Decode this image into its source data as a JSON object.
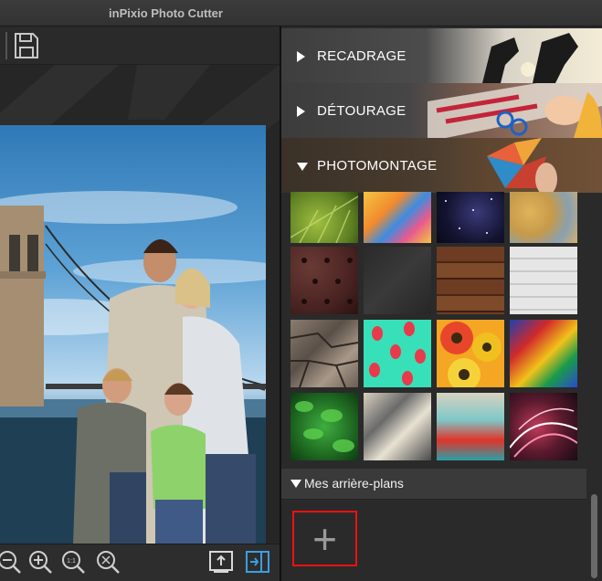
{
  "window": {
    "title": "inPixio Photo Cutter"
  },
  "toolbar": {
    "save_icon": "floppy-disk-icon"
  },
  "bottombar": {
    "icons": [
      "zoom-out-icon",
      "zoom-in-icon",
      "zoom-1to1-icon",
      "zoom-fit-icon",
      "export-icon",
      "toggle-panel-icon"
    ]
  },
  "panel": {
    "sections": [
      {
        "label": "RECADRAGE",
        "expanded": false
      },
      {
        "label": "DÉTOURAGE",
        "expanded": false
      },
      {
        "label": "PHOTOMONTAGE",
        "expanded": true
      }
    ],
    "backgrounds": [
      "green-leaf",
      "orange-paint-boards",
      "starry-sky",
      "peeling-paint",
      "brown-leather",
      "dark-textile",
      "wood-planks",
      "white-bricks",
      "stone-wall",
      "strawberries",
      "orange-flowers",
      "abstract-paint",
      "green-leaves",
      "graffiti-collage",
      "turquoise-paint",
      "light-trails"
    ],
    "my_backgrounds": {
      "label": "Mes arrière-plans",
      "add_label": "+"
    }
  },
  "colors": {
    "accent_blue": "#3aa0e0",
    "highlight_red": "#e11111"
  }
}
